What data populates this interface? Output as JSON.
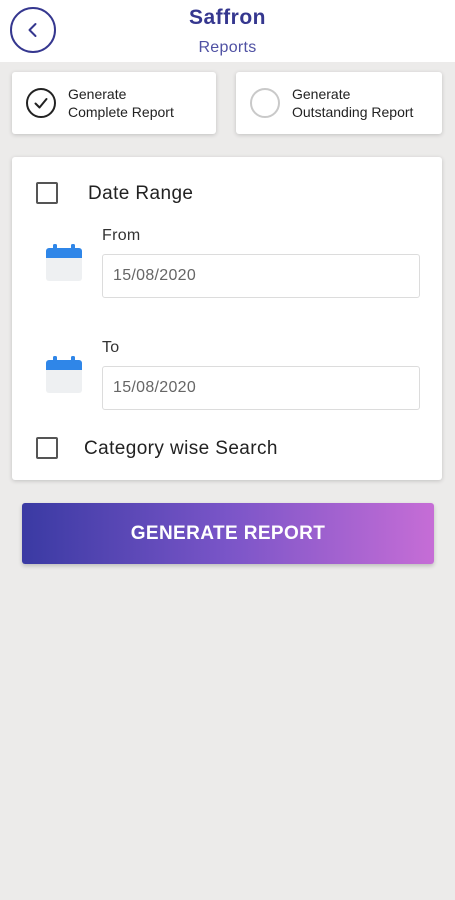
{
  "header": {
    "title": "Saffron",
    "subtitle": "Reports",
    "back_icon": "chevron-left-icon"
  },
  "report_types": {
    "complete": {
      "line1": "Generate",
      "line2": "Complete Report",
      "selected": true
    },
    "outstanding": {
      "line1": "Generate",
      "line2": "Outstanding Report",
      "selected": false
    }
  },
  "filters": {
    "date_range_label": "Date Range",
    "date_range_checked": false,
    "from_label": "From",
    "from_value": "15/08/2020",
    "to_label": "To",
    "to_value": "15/08/2020",
    "category_label": "Category wise Search",
    "category_checked": false
  },
  "actions": {
    "generate_label": "GENERATE REPORT"
  },
  "colors": {
    "primary": "#35378f",
    "calendar": "#2f86e8",
    "gradient_start": "#3a3aa3",
    "gradient_end": "#c66dd6",
    "background": "#ecebea"
  }
}
